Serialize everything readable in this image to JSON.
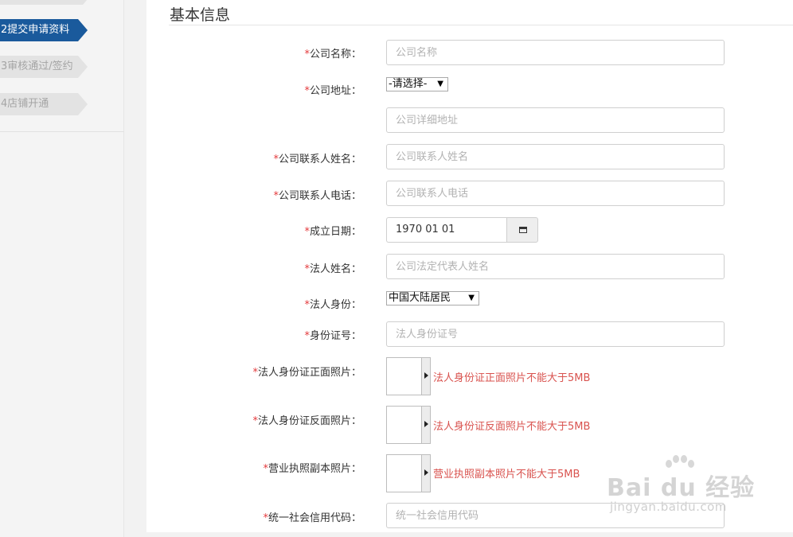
{
  "sidebar": {
    "steps": [
      {
        "label": ""
      },
      {
        "label": "2提交申请资料"
      },
      {
        "label": "3审核通过/签约"
      },
      {
        "label": "4店铺开通"
      }
    ]
  },
  "form": {
    "section_title": "基本信息",
    "required_mark": "*",
    "company_name": {
      "label": "公司名称：",
      "placeholder": "公司名称"
    },
    "company_address": {
      "label": "公司地址：",
      "select_value": "-请选择-",
      "detail_placeholder": "公司详细地址"
    },
    "contact_name": {
      "label": "公司联系人姓名：",
      "placeholder": "公司联系人姓名"
    },
    "contact_phone": {
      "label": "公司联系人电话：",
      "placeholder": "公司联系人电话"
    },
    "established_date": {
      "label": "成立日期：",
      "value": "1970 01 01"
    },
    "legal_name": {
      "label": "法人姓名：",
      "placeholder": "公司法定代表人姓名"
    },
    "legal_identity": {
      "label": "法人身份：",
      "select_value": "中国大陆居民"
    },
    "id_number": {
      "label": "身份证号：",
      "placeholder": "法人身份证号"
    },
    "id_front_photo": {
      "label": "法人身份证正面照片：",
      "hint": "法人身份证正面照片不能大于5MB"
    },
    "id_back_photo": {
      "label": "法人身份证反面照片：",
      "hint": "法人身份证反面照片不能大于5MB"
    },
    "license_photo": {
      "label": "营业执照副本照片：",
      "hint": "营业执照副本照片不能大于5MB"
    },
    "credit_code": {
      "label": "统一社会信用代码：",
      "placeholder": "统一社会信用代码"
    }
  },
  "watermark": {
    "brand": "Bai du 经验",
    "site": "jingyan.baidu.com"
  },
  "colors": {
    "active_step": "#1a5a9c",
    "required": "#e4393c",
    "hint": "#d9534f"
  }
}
